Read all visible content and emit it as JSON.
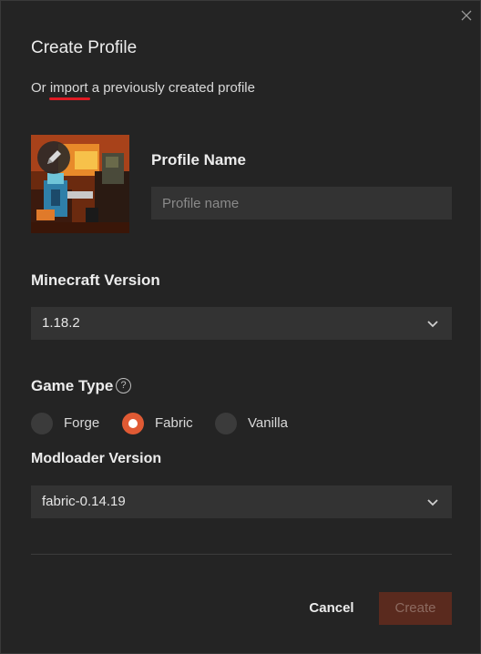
{
  "dialog": {
    "title": "Create Profile",
    "close_icon": "close-icon"
  },
  "import_line": {
    "prefix": "Or",
    "link": "import",
    "suffix": "a previously created profile"
  },
  "avatar": {
    "edit_icon": "pencil-icon"
  },
  "profile_name": {
    "label": "Profile Name",
    "placeholder": "Profile name",
    "value": ""
  },
  "minecraft_version": {
    "label": "Minecraft Version",
    "selected": "1.18.2"
  },
  "game_type": {
    "label": "Game Type",
    "help_icon": "?",
    "options": [
      {
        "label": "Forge",
        "selected": false
      },
      {
        "label": "Fabric",
        "selected": true
      },
      {
        "label": "Vanilla",
        "selected": false
      }
    ]
  },
  "modloader_version": {
    "label": "Modloader Version",
    "selected": "fabric-0.14.19"
  },
  "footer": {
    "cancel_label": "Cancel",
    "create_label": "Create"
  },
  "colors": {
    "accent": "#e05a34",
    "create_disabled_bg": "#5a2a1e",
    "background": "#242424",
    "field_bg": "#333333"
  }
}
